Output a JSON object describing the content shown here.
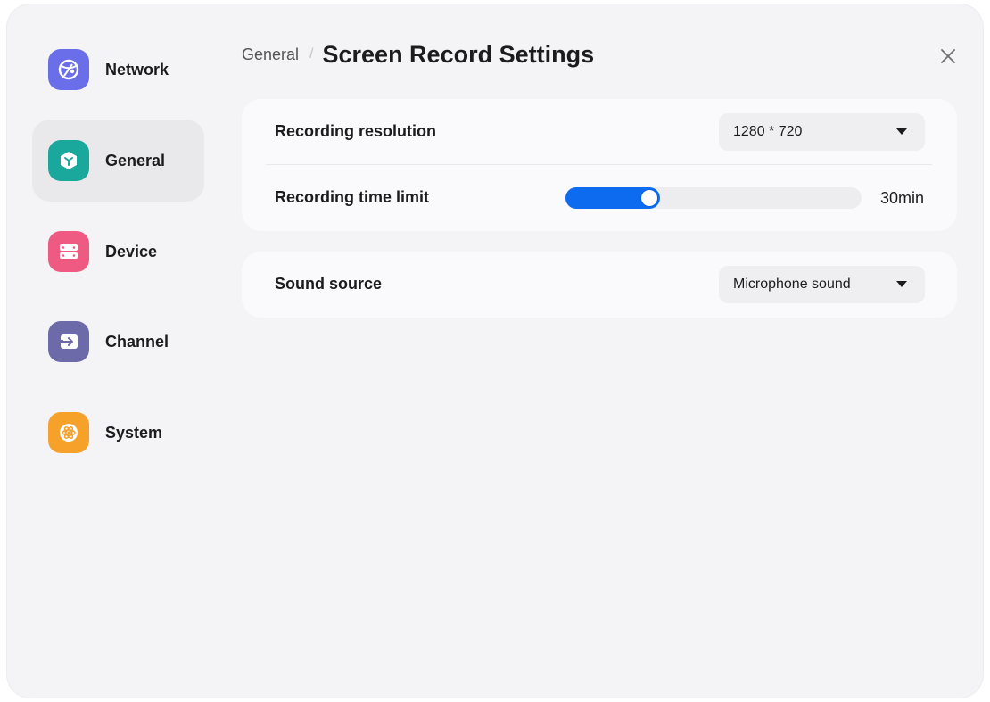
{
  "sidebar": {
    "items": [
      {
        "label": "Network",
        "icon": "network-globe-icon",
        "color": "#6a6ee8",
        "active": false
      },
      {
        "label": "General",
        "icon": "general-cube-icon",
        "color": "#1aa79c",
        "active": true
      },
      {
        "label": "Device",
        "icon": "device-server-icon",
        "color": "#ef5a83",
        "active": false
      },
      {
        "label": "Channel",
        "icon": "channel-input-icon",
        "color": "#6c6aa8",
        "active": false
      },
      {
        "label": "System",
        "icon": "system-atom-icon",
        "color": "#f6a12a",
        "active": false
      }
    ]
  },
  "header": {
    "breadcrumb_parent": "General",
    "separator": "/",
    "title": "Screen Record Settings",
    "close_icon": "close-icon"
  },
  "settings": {
    "resolution": {
      "label": "Recording resolution",
      "value": "1280 * 720"
    },
    "time_limit": {
      "label": "Recording time limit",
      "value_text": "30min",
      "level": 0.32
    },
    "sound_source": {
      "label": "Sound source",
      "value": "Microphone sound"
    }
  },
  "colors": {
    "accent": "#0d6bf0",
    "background": "#f4f4f6",
    "card": "#fafafc"
  }
}
